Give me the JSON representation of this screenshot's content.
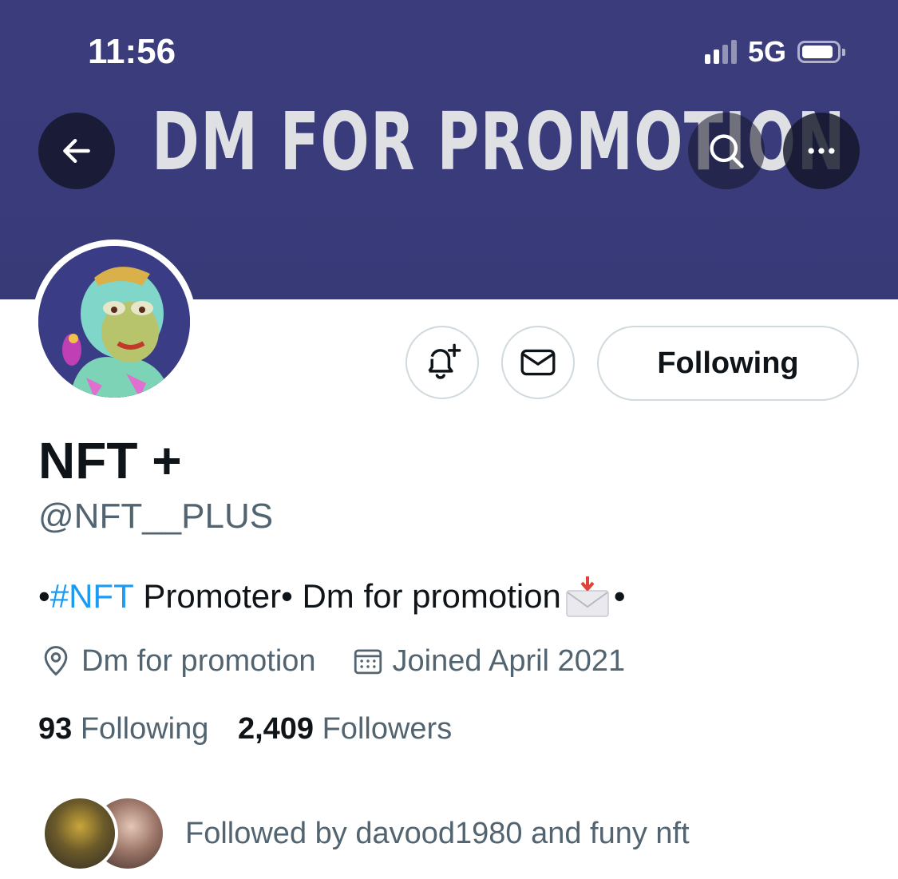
{
  "status_bar": {
    "time": "11:56",
    "network": "5G"
  },
  "banner": {
    "text": "DM FOR PROMOTION"
  },
  "profile": {
    "display_name": "NFT +",
    "handle": "@NFT__PLUS",
    "bio": {
      "prefix": "•",
      "hashtag": "#NFT",
      "rest": " Promoter• Dm for promotion",
      "suffix": "•"
    },
    "location": "Dm for promotion",
    "joined": "Joined April 2021",
    "following_count": "93",
    "following_label": "Following",
    "followers_count": "2,409",
    "followers_label": "Followers",
    "followed_by": "Followed by davood1980 and funy nft"
  },
  "actions": {
    "following_button": "Following"
  },
  "icons": {
    "back": "arrow-left-icon",
    "search": "search-icon",
    "more": "more-dots-icon",
    "notify": "bell-plus-icon",
    "message": "envelope-icon",
    "location": "location-pin-icon",
    "calendar": "calendar-icon"
  },
  "colors": {
    "banner": "#3b3c7c",
    "link": "#1d9bf0",
    "secondary_text": "#536471",
    "primary_text": "#0f1419",
    "border": "#cfd9de"
  }
}
